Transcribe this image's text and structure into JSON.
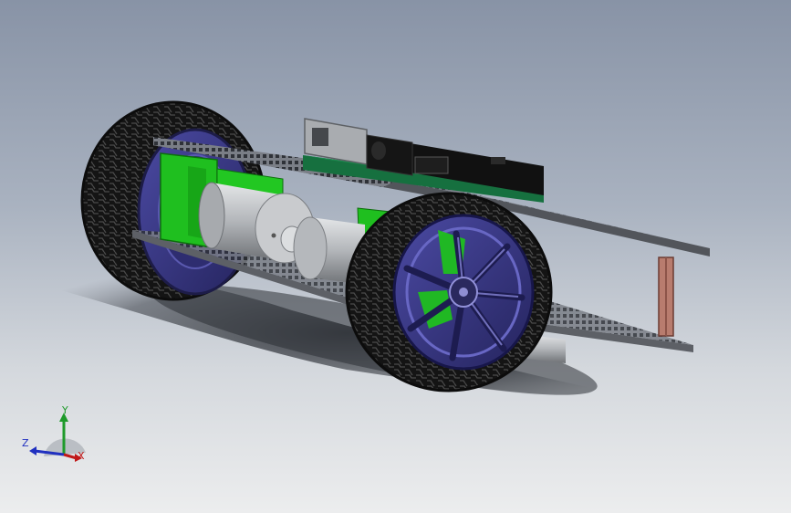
{
  "viewport": {
    "background_top": "#8893a6",
    "background_bottom": "#ecedee"
  },
  "model": {
    "colors": {
      "tire": "#1b1b1b",
      "rim": "#3b3a86",
      "motor_bracket": "#1fbf1f",
      "motor_body": "#b9bcc0",
      "chassis_plate": "#5d6066",
      "circuit_board": "#16703f",
      "standoff": "#b87c6e"
    },
    "icons": [
      "usb-connector-icon",
      "power-jack-icon"
    ]
  },
  "triad": {
    "y_label": "Y",
    "z_label": "Z",
    "x_label": "X",
    "colors": {
      "x": "#c01818",
      "y": "#1e9a2a",
      "z": "#2030c0"
    }
  }
}
